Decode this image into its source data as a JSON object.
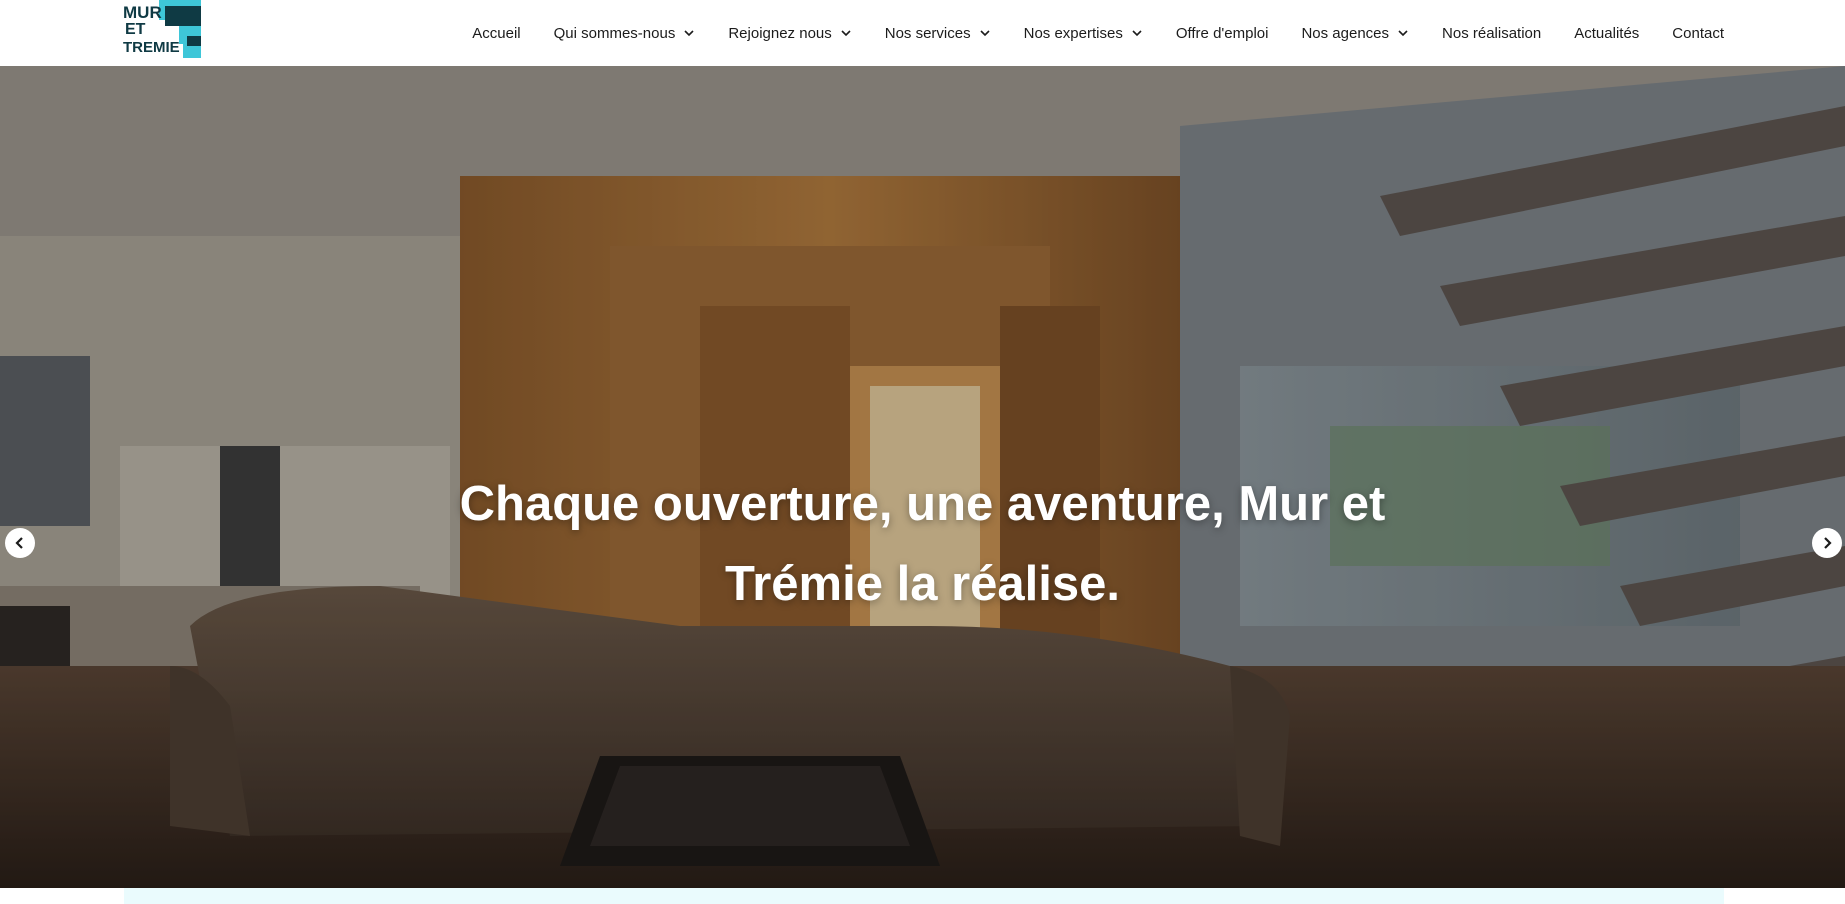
{
  "logo": {
    "lines": [
      "MUR",
      "ET",
      "TREMIE"
    ],
    "icon": "logo-mark"
  },
  "nav": {
    "items": [
      {
        "label": "Accueil",
        "has_dropdown": false
      },
      {
        "label": "Qui sommes-nous",
        "has_dropdown": true
      },
      {
        "label": "Rejoignez nous",
        "has_dropdown": true
      },
      {
        "label": "Nos services",
        "has_dropdown": true
      },
      {
        "label": "Nos expertises",
        "has_dropdown": true
      },
      {
        "label": "Offre d'emploi",
        "has_dropdown": false
      },
      {
        "label": "Nos agences",
        "has_dropdown": true
      },
      {
        "label": "Nos réalisation",
        "has_dropdown": false
      },
      {
        "label": "Actualités",
        "has_dropdown": false
      },
      {
        "label": "Contact",
        "has_dropdown": false
      }
    ],
    "dropdown_icon": "chevron-down-icon"
  },
  "hero": {
    "title_line1": "Chaque ouverture, une aventure, Mur et",
    "title_line2": "Trémie la réalise.",
    "prev_icon": "chevron-left-icon",
    "next_icon": "chevron-right-icon"
  },
  "colors": {
    "brand_teal": "#3ec6d8",
    "brand_dark": "#0f3a44",
    "nav_text": "#1c1c1c",
    "strip": "#eafbfd"
  }
}
